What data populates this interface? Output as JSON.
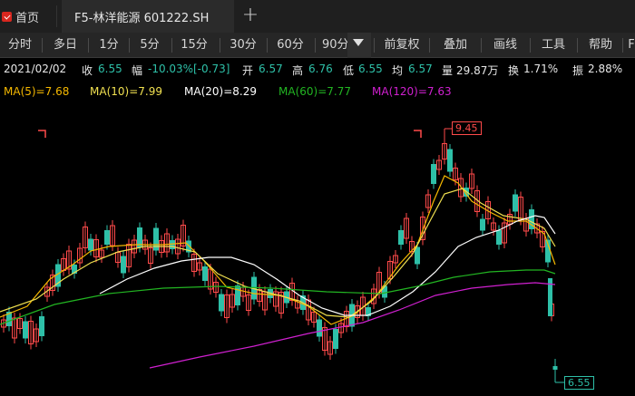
{
  "tabs": {
    "home_label": "首页",
    "active_label": "F5-林洋能源 601222.SH",
    "add_icon": "plus-icon"
  },
  "toolbar": {
    "periods": [
      "分时",
      "多日",
      "1分",
      "5分",
      "15分",
      "30分",
      "60分",
      "90分"
    ],
    "actions": [
      "前复权",
      "叠加",
      "画线",
      "工具",
      "帮助",
      "F"
    ]
  },
  "quote": {
    "date": "2021/02/02",
    "close_label": "收",
    "close": "6.55",
    "change_label": "幅",
    "change_pct": "-10.03%",
    "change_abs": "[-0.73]",
    "open_label": "开",
    "open": "6.57",
    "high_label": "高",
    "high": "6.76",
    "low_label": "低",
    "low": "6.55",
    "avg_label": "均",
    "avg": "6.57",
    "volume_label": "量",
    "volume": "29.87万",
    "turnover_label": "换",
    "turnover": "1.71%",
    "amplitude_label": "振",
    "amplitude": "2.88%"
  },
  "ma": {
    "ma5": "MA(5)=7.68",
    "ma10": "MA(10)=7.99",
    "ma20": "MA(20)=8.29",
    "ma60": "MA(60)=7.77",
    "ma120": "MA(120)=7.63"
  },
  "colors": {
    "up": "#ff4a4a",
    "down": "#2ec0a8",
    "ma5": "#f5b800",
    "ma10": "#f0e050",
    "ma20": "#ffffff",
    "ma60": "#22b522",
    "ma120": "#d020d0"
  },
  "chart_data": {
    "type": "candlestick",
    "high_marker": "9.45",
    "last_close_marker": "6.55"
  }
}
